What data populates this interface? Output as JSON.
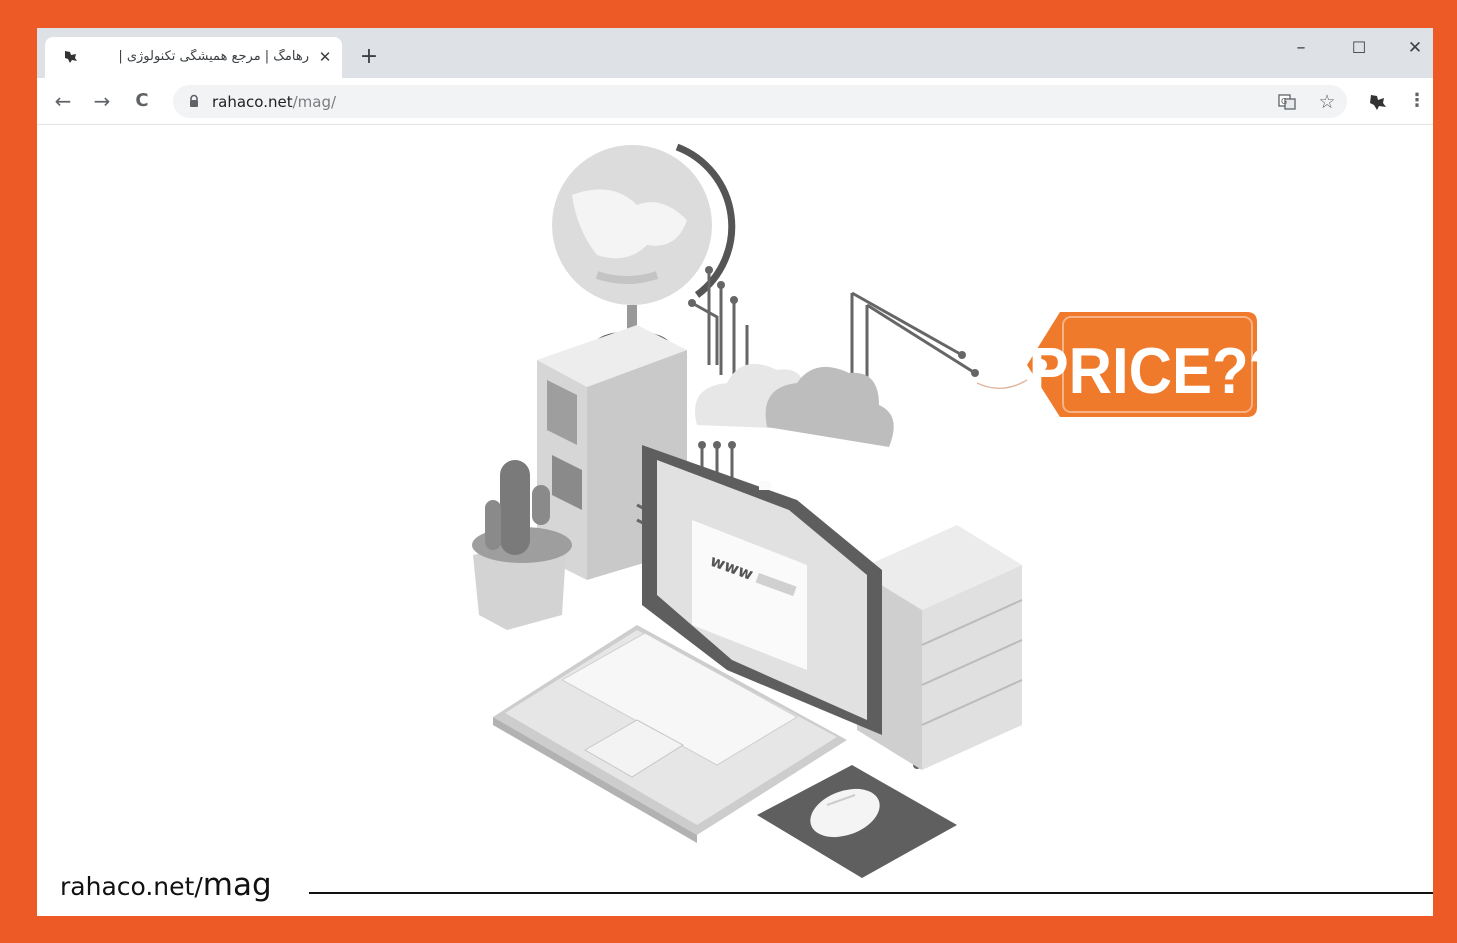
{
  "browser": {
    "tab": {
      "title": "رهامگ | مرجع همیشگی تکنولوژی |",
      "favicon": "rahaco-logo-icon",
      "close_label": "✕"
    },
    "new_tab_label": "+",
    "window_controls": {
      "minimize": "–",
      "maximize": "☐",
      "close": "✕"
    },
    "toolbar": {
      "back": "←",
      "forward": "→",
      "reload": "C",
      "url_host": "rahaco.net",
      "url_path": "/mag/",
      "translate_icon": "translate-icon",
      "bookmark_star": "☆",
      "menu": "⋮"
    }
  },
  "content": {
    "price_tag_text": "PRICE??",
    "screen_text": "www",
    "footer": {
      "site": "rahaco.net/",
      "section": "mag"
    }
  },
  "colors": {
    "frame": "#ee5a26",
    "tag_orange": "#f07a2c",
    "tabstrip": "#dee1e6"
  }
}
